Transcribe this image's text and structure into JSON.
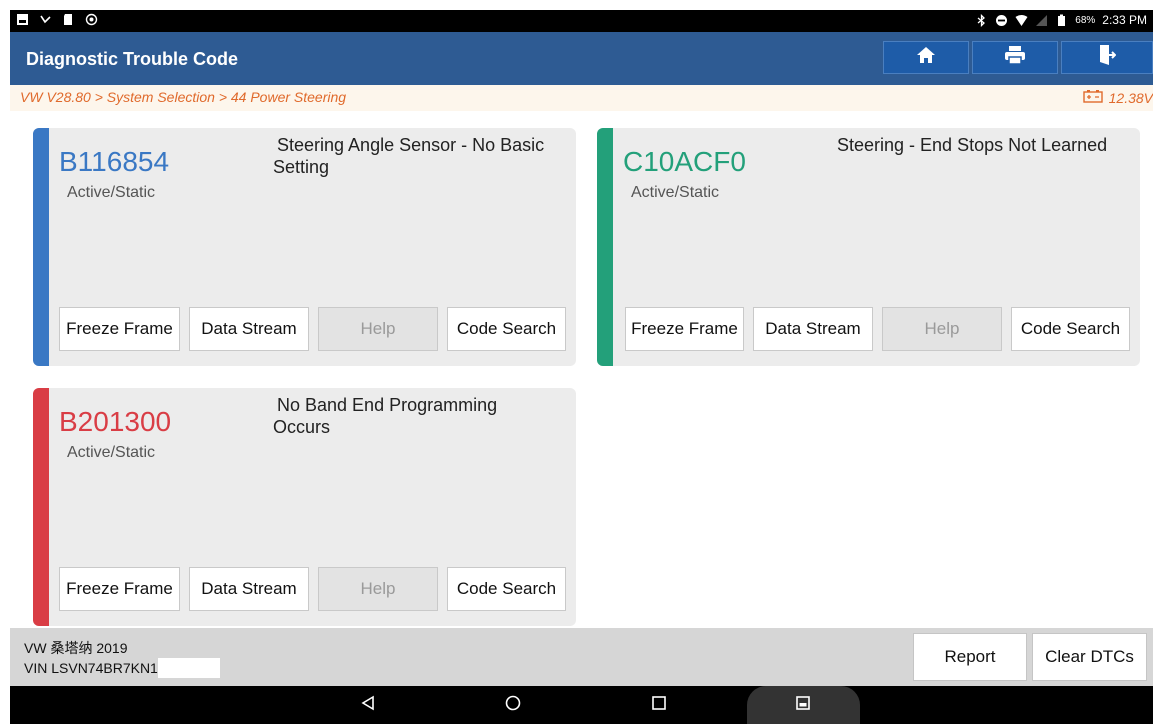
{
  "statusbar": {
    "battery_percent": "68%",
    "time": "2:33 PM"
  },
  "header": {
    "title": "Diagnostic Trouble Code",
    "buttons": [
      "home-icon",
      "print-icon",
      "exit-icon"
    ]
  },
  "breadcrumb": {
    "path": "VW V28.80 > System Selection > 44 Power Steering",
    "voltage": "12.38V"
  },
  "colors": {
    "header_bg": "#2e5b93",
    "accent_orange": "#e06a2c",
    "code_blue": "#3a78c4",
    "code_green": "#23a07a",
    "code_red": "#d93d45"
  },
  "dtcs": [
    {
      "code": "B116854",
      "status": "Active/Static",
      "description_line1": "Steering Angle Sensor - No Basic",
      "description_line2": "Setting",
      "color": "#3a78c4",
      "buttons": {
        "freeze_frame": "Freeze Frame",
        "data_stream": "Data Stream",
        "help": "Help",
        "code_search": "Code Search"
      }
    },
    {
      "code": "C10ACF0",
      "status": "Active/Static",
      "description_line1": "Steering - End Stops Not Learned",
      "description_line2": "",
      "color": "#23a07a",
      "buttons": {
        "freeze_frame": "Freeze Frame",
        "data_stream": "Data Stream",
        "help": "Help",
        "code_search": "Code Search"
      }
    },
    {
      "code": "B201300",
      "status": "Active/Static",
      "description_line1": "No Band End Programming",
      "description_line2": "Occurs",
      "color": "#d93d45",
      "buttons": {
        "freeze_frame": "Freeze Frame",
        "data_stream": "Data Stream",
        "help": "Help",
        "code_search": "Code Search"
      }
    }
  ],
  "footer": {
    "vehicle": "VW 桑塔纳 2019",
    "vin": "VIN LSVN74BR7KN1",
    "report_label": "Report",
    "clear_label": "Clear DTCs"
  },
  "navbar": {
    "buttons": [
      "back-icon",
      "home-circle-icon",
      "recents-icon",
      "screenshot-icon"
    ]
  }
}
